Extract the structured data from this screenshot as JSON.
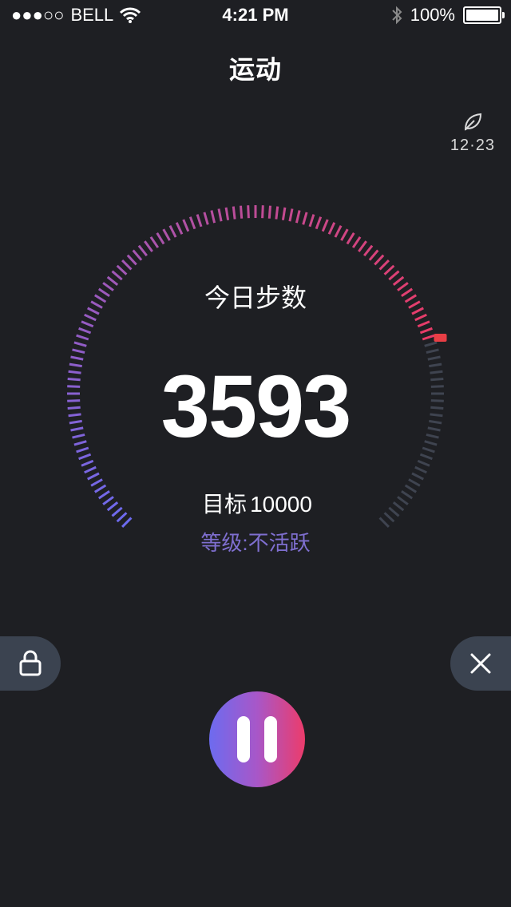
{
  "status_bar": {
    "signal_dots": "●●●○○",
    "carrier": "BELL",
    "time": "4:21 PM",
    "battery_text": "100%",
    "battery_level": 1.0,
    "icons": [
      "wifi-icon",
      "bluetooth-icon",
      "battery-icon"
    ]
  },
  "header": {
    "title": "运动"
  },
  "top_right": {
    "icon": "leaf-icon",
    "time": "12·23"
  },
  "gauge": {
    "label": "今日步数",
    "steps": "3593",
    "goal_label": "目标",
    "goal_value": "10000",
    "level": "等级:不活跃",
    "progress": 0.77,
    "colors": {
      "start": "#6d6bef",
      "end": "#ea3b66",
      "inactive": "#3f4450",
      "marker": "#e83e45"
    }
  },
  "controls": {
    "lock_icon": "lock-icon",
    "close_icon": "close-icon",
    "pause_icon": "pause-icon"
  }
}
